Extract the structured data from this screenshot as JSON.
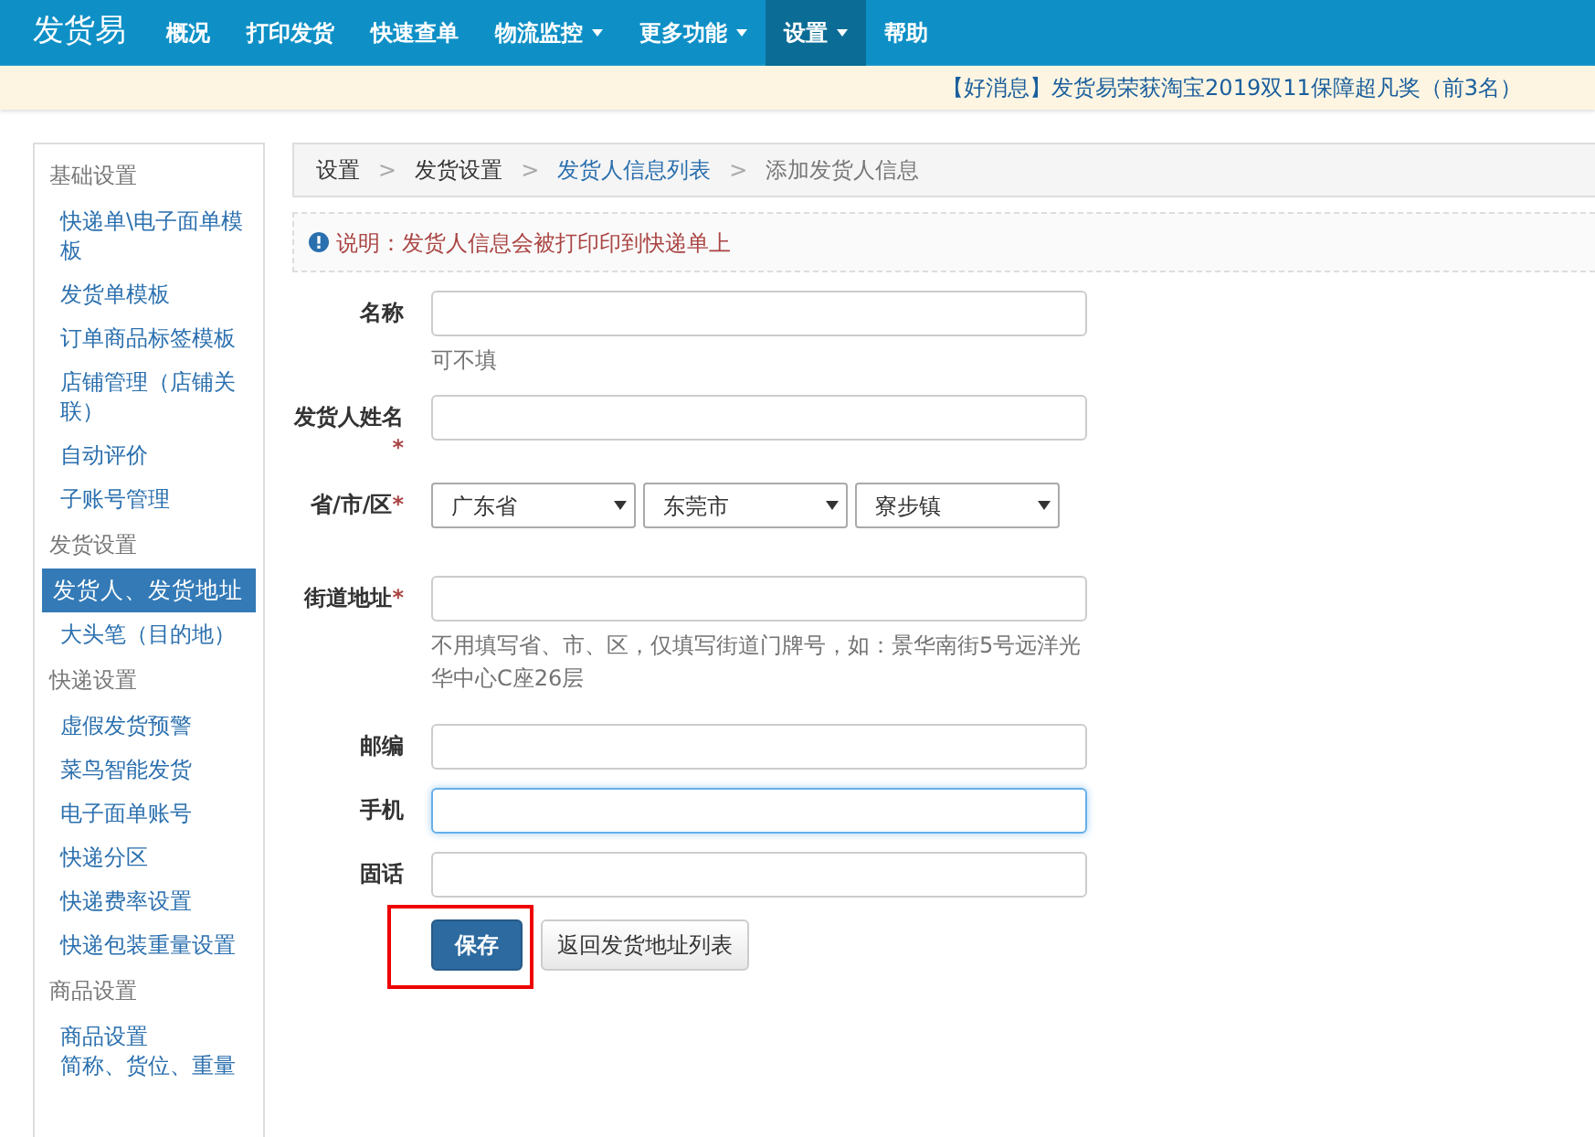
{
  "navbar": {
    "brand": "发货易",
    "items": [
      {
        "label": "概况",
        "dropdown": false,
        "selected": false
      },
      {
        "label": "打印发货",
        "dropdown": false,
        "selected": false
      },
      {
        "label": "快速查单",
        "dropdown": false,
        "selected": false
      },
      {
        "label": "物流监控",
        "dropdown": true,
        "selected": false
      },
      {
        "label": "更多功能",
        "dropdown": true,
        "selected": false
      },
      {
        "label": "设置",
        "dropdown": true,
        "selected": true
      },
      {
        "label": "帮助",
        "dropdown": false,
        "selected": false
      }
    ]
  },
  "notice": "【好消息】发货易荣获淘宝2019双11保障超凡奖（前3名）",
  "sidebar": {
    "groups": [
      {
        "title": "基础设置",
        "items": [
          {
            "label": "快递单\\电子面单模板",
            "selected": false
          },
          {
            "label": "发货单模板",
            "selected": false
          },
          {
            "label": "订单商品标签模板",
            "selected": false
          },
          {
            "label": "店铺管理（店铺关联）",
            "selected": false
          },
          {
            "label": "自动评价",
            "selected": false
          },
          {
            "label": "子账号管理",
            "selected": false
          }
        ]
      },
      {
        "title": "发货设置",
        "items": [
          {
            "label": "发货人、发货地址",
            "selected": true
          },
          {
            "label": "大头笔（目的地）",
            "selected": false
          }
        ]
      },
      {
        "title": "快递设置",
        "items": [
          {
            "label": "虚假发货预警",
            "selected": false
          },
          {
            "label": "菜鸟智能发货",
            "selected": false
          },
          {
            "label": "电子面单账号",
            "selected": false
          },
          {
            "label": "快递分区",
            "selected": false
          },
          {
            "label": "快递费率设置",
            "selected": false
          },
          {
            "label": "快递包装重量设置",
            "selected": false
          }
        ]
      },
      {
        "title": "商品设置",
        "items": [
          {
            "label": "商品设置",
            "detail": "简称、货位、重量",
            "selected": false
          }
        ]
      }
    ]
  },
  "breadcrumb_separator": ">",
  "required_mark": "*",
  "breadcrumb": [
    {
      "label": "设置",
      "kind": "plain"
    },
    {
      "label": "发货设置",
      "kind": "plain"
    },
    {
      "label": "发货人信息列表",
      "kind": "link"
    },
    {
      "label": "添加发货人信息",
      "kind": "current"
    }
  ],
  "note": {
    "label": "说明：",
    "text": "发货人信息会被打印印到快递单上"
  },
  "form": [
    {
      "kind": "text",
      "label": "名称",
      "required": false,
      "help": "可不填",
      "focused": false
    },
    {
      "kind": "text",
      "label": "发货人姓名",
      "required": true,
      "focused": false
    },
    {
      "kind": "selects",
      "label": "省/市/区",
      "required": true,
      "options": [
        "广东省",
        "东莞市",
        "寮步镇"
      ]
    },
    {
      "kind": "text",
      "label": "街道地址",
      "required": true,
      "help": "不用填写省、市、区，仅填写街道门牌号，如：景华南街5号远洋光华中心C座26层",
      "focused": false
    },
    {
      "kind": "text",
      "label": "邮编",
      "required": false,
      "focused": false
    },
    {
      "kind": "text",
      "label": "手机",
      "required": false,
      "focused": true
    },
    {
      "kind": "text",
      "label": "固话",
      "required": false,
      "focused": false
    }
  ],
  "buttons": [
    {
      "label": "保存",
      "kind": "primary",
      "highlighted": true
    },
    {
      "label": "返回发货地址列表",
      "kind": "default",
      "highlighted": false
    }
  ]
}
